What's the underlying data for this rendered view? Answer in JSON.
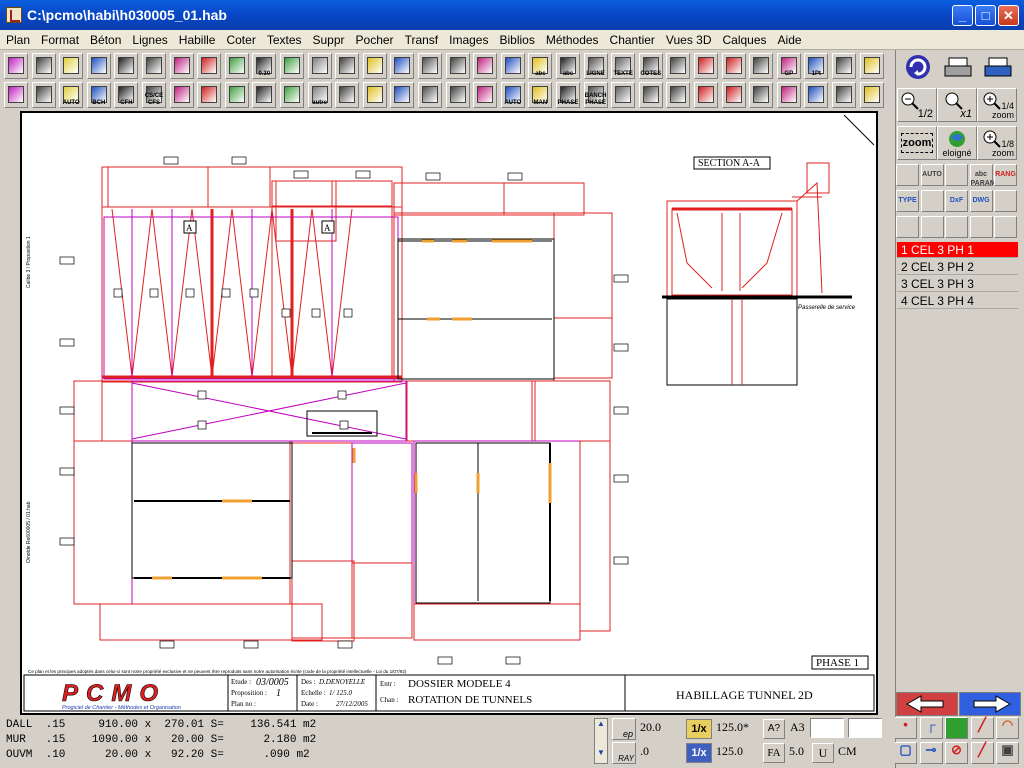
{
  "window": {
    "title": "C:\\pcmo\\habi\\h030005_01.hab"
  },
  "menu": [
    "Plan",
    "Format",
    "Béton",
    "Lignes",
    "Habille",
    "Coter",
    "Textes",
    "Suppr",
    "Pocher",
    "Transf",
    "Images",
    "Biblios",
    "Méthodes",
    "Chantier",
    "Vues 3D",
    "Calques",
    "Aide"
  ],
  "toolbar1_labels": [
    "",
    "",
    "",
    "",
    "",
    "",
    "",
    "",
    "",
    "0.30",
    "",
    "",
    "",
    "",
    "",
    "",
    "",
    "",
    "",
    "abc",
    "abc",
    "LIGNE",
    "TEXTE",
    "COTES",
    "",
    "",
    "",
    "",
    "GP",
    "1Pt",
    "",
    ""
  ],
  "toolbar2_labels": [
    "",
    "",
    "AUTO",
    "BCH",
    "CFH",
    "CS/CE CFS",
    "",
    "",
    "",
    "",
    "",
    "autre",
    "",
    "",
    "",
    "",
    "",
    "",
    "AUTO",
    "MAN",
    "PHASE",
    "BANCH PHASE",
    "",
    "",
    "",
    "",
    "",
    "",
    "",
    "",
    "",
    ""
  ],
  "right_panel": {
    "zoom_half": "1/2",
    "zoom_x1": "x1",
    "zoom_quarter": "1/4 zoom",
    "zoom_btn": "zoom",
    "eloigne": "eloigné",
    "zoom_eighth": "1/8 zoom",
    "tools": [
      "",
      "AUTO",
      "",
      "abc PARAM",
      "RANG",
      "TYPE",
      "",
      "DxF",
      "DWG",
      "",
      "",
      "",
      "",
      "",
      ""
    ],
    "layers": [
      "1 CEL  3 PH  1",
      "2 CEL  3 PH  2",
      "3 CEL  3 PH  3",
      "4 CEL  3 PH  4"
    ]
  },
  "drawing": {
    "section_title": "SECTION A-A",
    "passerelle": "Passerelle de service",
    "phase": "PHASE  1",
    "disclaimer": "Ce plan et les principes adoptés dans celui-ci sont notre propriété exclusive et ne peuvent être reproduits sans notre autorisation écrite (code de la propriété intellectuelle - Loi du 1/07/92)",
    "margin_top": "Calibe 3 / Proposition 1",
    "margin_bottom": "Oinotde Re600005 / 01.hab",
    "logo": "PCMO",
    "logo_tagline": "Progiciel de Chantier - Méthodes et Organisation",
    "etude_label": "Etude :",
    "etude_value": "03/0005",
    "proposition_label": "Proposition :",
    "proposition_value": "1",
    "planno_label": "Plan no :",
    "des_label": "Des :",
    "des_value": "D.DENOYELLE",
    "echelle_label": "Echelle :",
    "echelle_value": "1/ 125.0",
    "date_label": "Date :",
    "date_value": "27/12/2005",
    "entr_label": "Entr :",
    "entr_value": "DOSSIER MODELE 4",
    "chan_label": "Chan :",
    "chan_value": "ROTATION DE TUNNELS",
    "doc_title": "HABILLAGE TUNNEL 2D",
    "marker_a": "A"
  },
  "status": {
    "lines": [
      "DALL  .15     910.00 x  270.01 S=    136.541 m2",
      "MUR   .15    1090.00 x   20.00 S=      2.180 m2",
      "OUVM  .10      20.00 x   92.20 S=      .090 m2"
    ],
    "ep_label": "ep",
    "ep_value": "20.0",
    "ray_label": "RAY",
    "ray_value": ".0",
    "scale_label_1": "1/x",
    "scale_value_1": "125.0*",
    "scale_label_2": "1/x",
    "scale_value_2": "125.0",
    "a_btn": "A?",
    "format": "A3",
    "fa": "FA",
    "fa_value": "5.0",
    "u": "U",
    "cm": "CM"
  }
}
